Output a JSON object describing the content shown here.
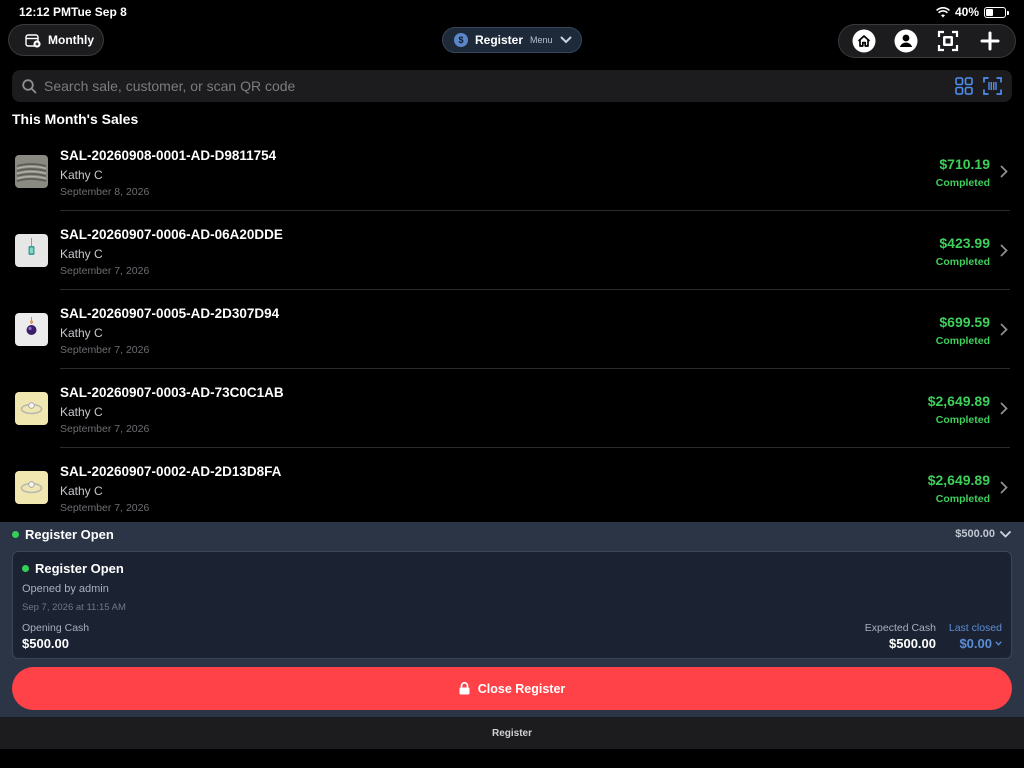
{
  "status_bar": {
    "time": "12:12 PM",
    "date": "Tue Sep 8",
    "battery": "40%"
  },
  "header": {
    "period_label": "Monthly",
    "register_menu": {
      "label": "Register",
      "sub_label": "Menu",
      "icon": "dollar-circle-icon"
    },
    "actions": [
      "home-icon",
      "profile-icon",
      "scan-icon",
      "plus-icon"
    ]
  },
  "search": {
    "placeholder": "Search sale, customer, or scan QR code",
    "value": ""
  },
  "section_title": "This Month's Sales",
  "sales": [
    {
      "id": "SAL-20260908-0001-AD-D9811754",
      "customer": "Kathy C",
      "date": "September 8, 2026",
      "amount": "$710.19",
      "status": "Completed",
      "thumb_color": "#8a8a82"
    },
    {
      "id": "SAL-20260907-0006-AD-06A20DDE",
      "customer": "Kathy C",
      "date": "September 7, 2026",
      "amount": "$423.99",
      "status": "Completed",
      "thumb_color": "#e6e6e6"
    },
    {
      "id": "SAL-20260907-0005-AD-2D307D94",
      "customer": "Kathy C",
      "date": "September 7, 2026",
      "amount": "$699.59",
      "status": "Completed",
      "thumb_color": "#ececec"
    },
    {
      "id": "SAL-20260907-0003-AD-73C0C1AB",
      "customer": "Kathy C",
      "date": "September 7, 2026",
      "amount": "$2,649.89",
      "status": "Completed",
      "thumb_color": "#efe6b0"
    },
    {
      "id": "SAL-20260907-0002-AD-2D13D8FA",
      "customer": "Kathy C",
      "date": "September 7, 2026",
      "amount": "$2,649.89",
      "status": "Completed",
      "thumb_color": "#efe6b0"
    }
  ],
  "register": {
    "header_label": "Register Open",
    "header_amount": "$500.00",
    "card_title": "Register Open",
    "opened_by": "Opened by admin",
    "opened_at": "Sep 7, 2026 at 11:15 AM",
    "opening_cash_label": "Opening Cash",
    "opening_cash": "$500.00",
    "expected_cash_label": "Expected Cash",
    "expected_cash": "$500.00",
    "last_closed_label": "Last closed",
    "last_closed": "$0.00",
    "close_button": "Close Register"
  },
  "bottom_tab": "Register",
  "colors": {
    "accent_green": "#3ecf5a",
    "close_red": "#ff4247",
    "link_blue": "#5b8dd6",
    "panel": "#2c3545"
  }
}
